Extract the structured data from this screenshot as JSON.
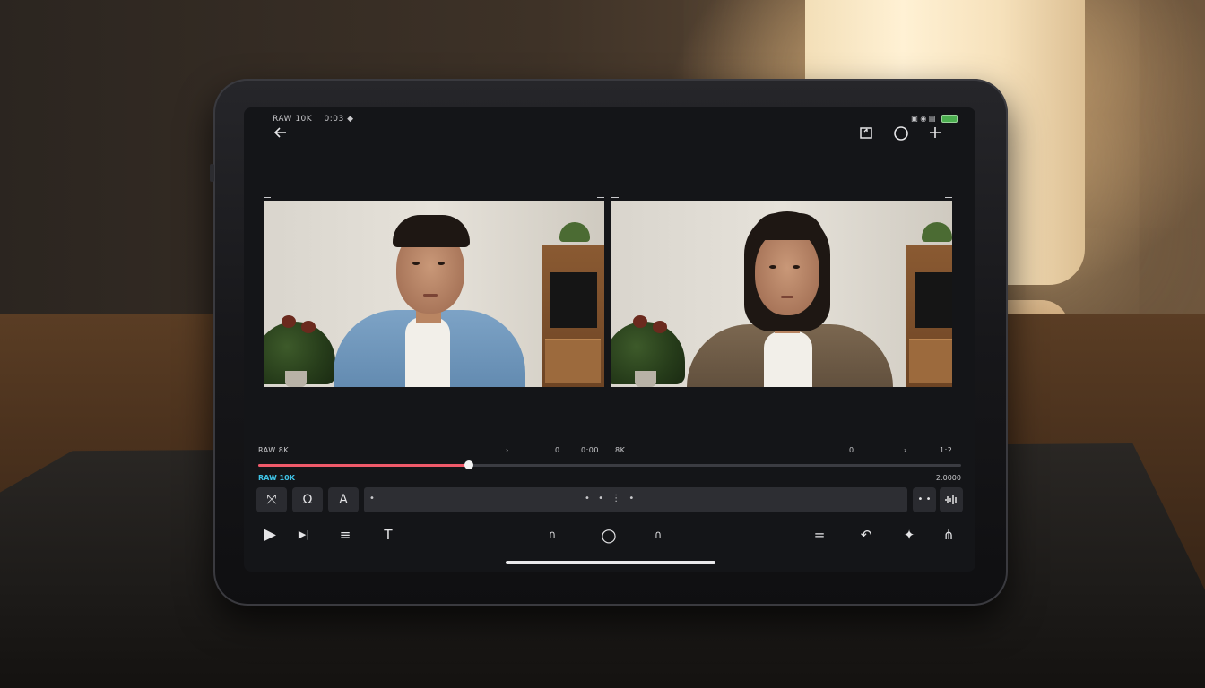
{
  "status_bar": {
    "left_text": "RAW 10K",
    "left_secondary": "0:03 ◆",
    "right_icons": "▣ ◉ ▤"
  },
  "toolbar": {
    "back_icon": "arrow-left-icon",
    "export_icon": "export-icon",
    "record_icon": "circle-icon",
    "add_icon": "plus-icon"
  },
  "timeline": {
    "left_time": "RAW 8K",
    "mid_markers": [
      "›",
      "0",
      "0:00",
      "8K"
    ],
    "right_markers": [
      "0",
      "›",
      "1:2"
    ],
    "progress_fraction": 0.3,
    "track_label": "RAW 10K",
    "track_time": "2:0000"
  },
  "tools": {
    "move_tool": "⤧",
    "mask_tool": "Ω",
    "text_tool": "A",
    "clip_markers": "• • ⋮ •",
    "clip_start": "•",
    "end_marker": "• •"
  },
  "controls": {
    "play": "▶",
    "next_frame": "▶|",
    "menu": "≡",
    "title_tool": "T",
    "prev_marker": "∩",
    "record": "○",
    "next_marker": "∩",
    "split": "=",
    "undo": "↶",
    "star": "✦",
    "grid": "⋔"
  },
  "colors": {
    "accent_red": "#f05a6a",
    "accent_cyan": "#3fc3e6"
  }
}
